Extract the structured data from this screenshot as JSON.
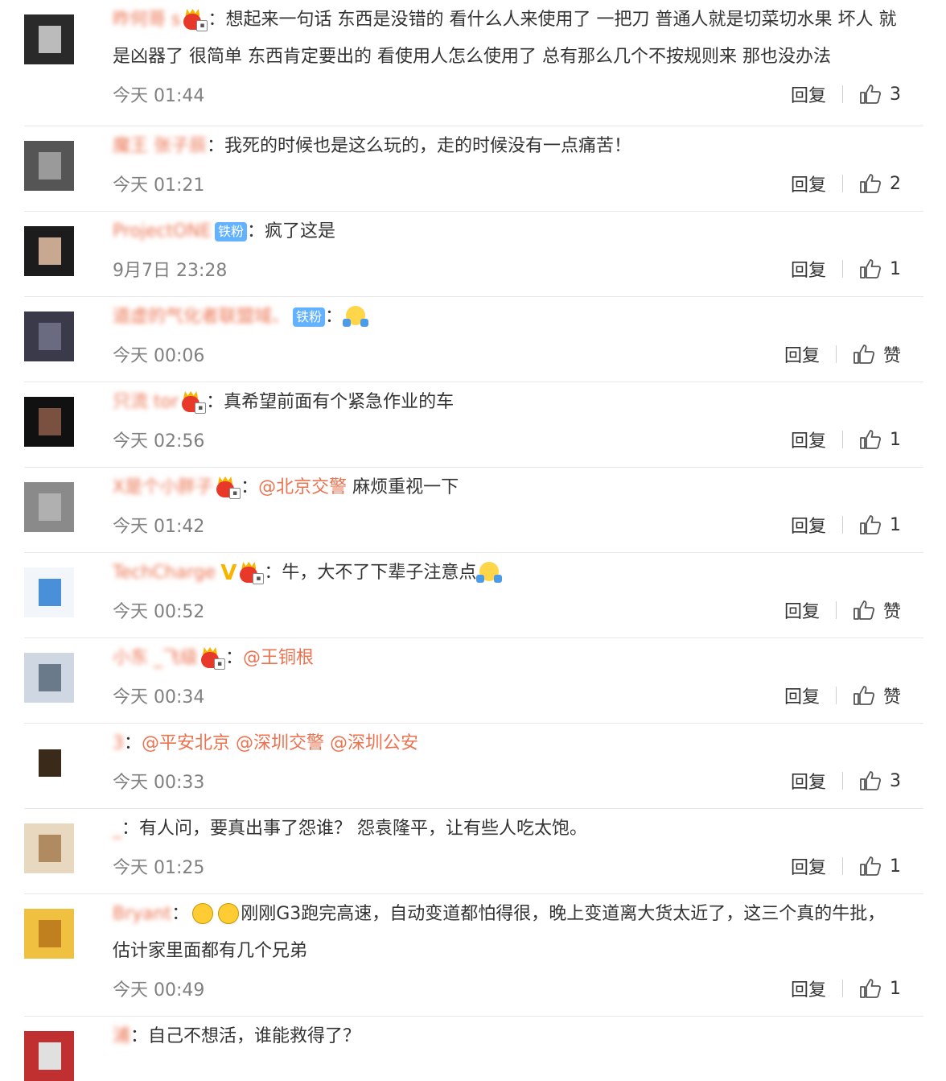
{
  "labels": {
    "reply": "回复",
    "colon": "："
  },
  "comments": [
    {
      "user": "昨何哥 s",
      "badge": "crown",
      "segments": [
        {
          "t": "text",
          "v": "想起来一句话 东西是没错的 看什么人来使用了 一把刀 普通人就是切菜切水果 坏人 就是凶器了 很简单 东西肯定要出的 看使用人怎么使用了 总有那么几个不按规则来 那也没办法"
        }
      ],
      "time": "今天 01:44",
      "likes": "3"
    },
    {
      "user": "魔王 张子辰",
      "badge": "",
      "segments": [
        {
          "t": "text",
          "v": "我死的时候也是这么玩的，走的时候没有一点痛苦！"
        }
      ],
      "time": "今天 01:21",
      "likes": "2"
    },
    {
      "user": "ProjectONE",
      "badge": "fan",
      "fan_label": "铁粉",
      "segments": [
        {
          "t": "text",
          "v": "疯了这是"
        }
      ],
      "time": "9月7日 23:28",
      "likes": "1"
    },
    {
      "user": "道虚的气化者联盟域、",
      "badge": "fan",
      "fan_label": "铁粉",
      "segments": [
        {
          "t": "emoji",
          "v": "shrug"
        }
      ],
      "time": "今天 00:06",
      "likes": "赞"
    },
    {
      "user": "只流 tor",
      "badge": "crown",
      "segments": [
        {
          "t": "text",
          "v": "真希望前面有个紧急作业的车"
        }
      ],
      "time": "今天 02:56",
      "likes": "1"
    },
    {
      "user": "X是个小胖子",
      "badge": "crown",
      "segments": [
        {
          "t": "at",
          "v": "@北京交警"
        },
        {
          "t": "text",
          "v": " 麻烦重视一下"
        }
      ],
      "time": "今天 01:42",
      "likes": "1"
    },
    {
      "user": "TechCharge",
      "badge": "vcrown",
      "segments": [
        {
          "t": "text",
          "v": "牛，大不了下辈子注意点"
        },
        {
          "t": "emoji",
          "v": "shrug"
        }
      ],
      "time": "今天 00:52",
      "likes": "赞"
    },
    {
      "user": "小东 _飞级",
      "badge": "crown",
      "segments": [
        {
          "t": "at",
          "v": "@王铜根"
        }
      ],
      "time": "今天 00:34",
      "likes": "赞"
    },
    {
      "user": "3",
      "badge": "",
      "segments": [
        {
          "t": "at",
          "v": "@平安北京"
        },
        {
          "t": "text",
          "v": " "
        },
        {
          "t": "at",
          "v": "@深圳交警"
        },
        {
          "t": "text",
          "v": " "
        },
        {
          "t": "at",
          "v": "@深圳公安"
        }
      ],
      "time": "今天 00:33",
      "likes": "3"
    },
    {
      "user": "_",
      "badge": "",
      "segments": [
        {
          "t": "text",
          "v": "有人问，要真出事了怨谁？ 怨袁隆平，让有些人吃太饱。"
        }
      ],
      "time": "今天 01:25",
      "likes": "1"
    },
    {
      "user": "Bryant",
      "badge": "",
      "segments": [
        {
          "t": "emoji",
          "v": "laugh"
        },
        {
          "t": "emoji",
          "v": "laugh"
        },
        {
          "t": "text",
          "v": "刚刚G3跑完高速，自动变道都怕得很，晚上变道离大货太近了，这三个真的牛批，估计家里面都有几个兄弟"
        }
      ],
      "time": "今天 00:49",
      "likes": "1"
    },
    {
      "user": "浦",
      "badge": "",
      "segments": [
        {
          "t": "text",
          "v": "自己不想活，谁能救得了？"
        }
      ],
      "time": "",
      "likes": ""
    }
  ]
}
